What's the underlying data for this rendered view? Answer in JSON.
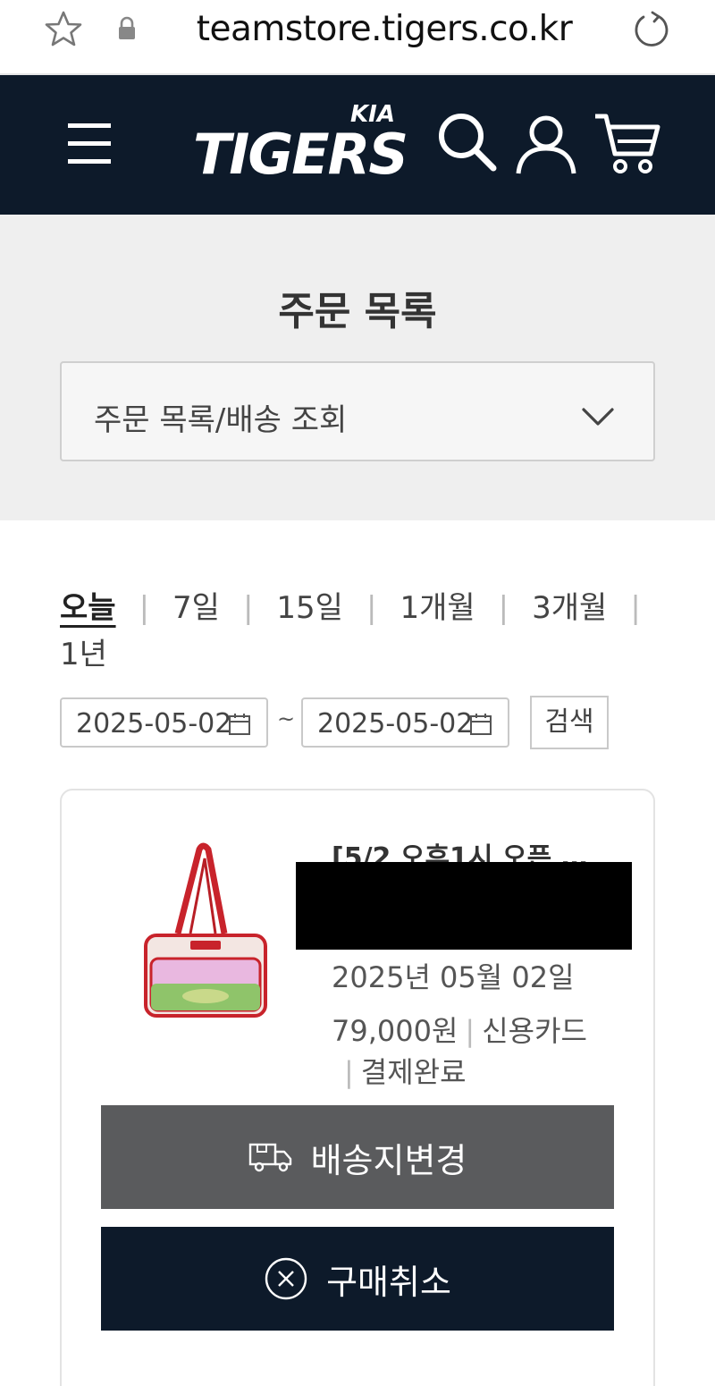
{
  "browser": {
    "url": "teamstore.tigers.co.kr"
  },
  "header": {
    "logo_text": "TIGERS",
    "brand_text": "KIA",
    "bg_color": "#0d1a2a"
  },
  "page": {
    "title": "주문 목록",
    "dropdown_value": "주문 목록/배송 조회"
  },
  "filter": {
    "periods": [
      {
        "label": "오늘",
        "active": true
      },
      {
        "label": "7일",
        "active": false
      },
      {
        "label": "15일",
        "active": false
      },
      {
        "label": "1개월",
        "active": false
      },
      {
        "label": "3개월",
        "active": false
      },
      {
        "label": "1년",
        "active": false
      }
    ],
    "date_from": "2025-05-02",
    "date_to": "2025-05-02",
    "tilde": "~",
    "search_label": "검색"
  },
  "order": {
    "product_name": "[5/2 오후1시 오픈 …",
    "date": "2025년 05월 02일",
    "price": "79,000원",
    "payment_method": "신용카드",
    "status": "결제완료",
    "buttons": {
      "change_address": "배송지변경",
      "cancel": "구매취소"
    }
  },
  "colors": {
    "navy": "#0d1a2a",
    "gray_button": "#5a5b5d",
    "bag_red": "#d0232a"
  }
}
